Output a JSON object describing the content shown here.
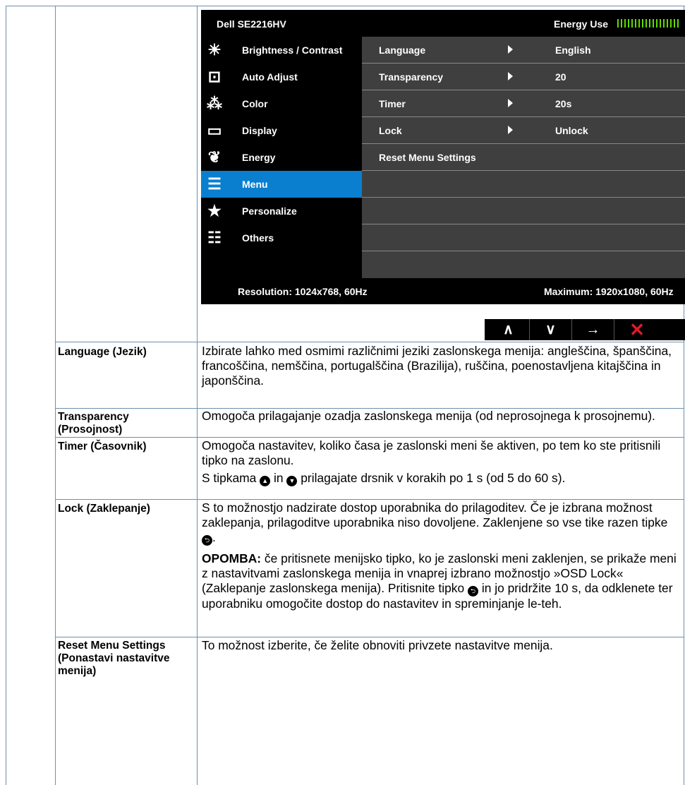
{
  "osd": {
    "title": "Dell SE2216HV",
    "energy_label": "Energy Use",
    "resolution": "Resolution: 1024x768, 60Hz",
    "maximum": "Maximum: 1920x1080, 60Hz",
    "menu_items": [
      {
        "label": "Brightness / Contrast",
        "icon": "brightness-icon",
        "glyph": "☀"
      },
      {
        "label": "Auto Adjust",
        "icon": "auto-adjust-icon",
        "glyph": "⊡"
      },
      {
        "label": "Color",
        "icon": "color-icon",
        "glyph": "⁂"
      },
      {
        "label": "Display",
        "icon": "display-icon",
        "glyph": "▭"
      },
      {
        "label": "Energy",
        "icon": "energy-icon",
        "glyph": "❦"
      },
      {
        "label": "Menu",
        "icon": "menu-icon",
        "glyph": "☰"
      },
      {
        "label": "Personalize",
        "icon": "star-icon",
        "glyph": "★"
      },
      {
        "label": "Others",
        "icon": "others-icon",
        "glyph": "☷"
      }
    ],
    "settings": [
      {
        "name": "Language",
        "value": "English"
      },
      {
        "name": "Transparency",
        "value": "20"
      },
      {
        "name": "Timer",
        "value": "20s"
      },
      {
        "name": "Lock",
        "value": "Unlock"
      },
      {
        "name": "Reset Menu Settings",
        "value": ""
      }
    ],
    "active_item": "Menu",
    "accent_color": "#0a7fd0"
  },
  "nav_buttons": {
    "up": "∧",
    "down": "∨",
    "enter": "→",
    "exit": "✕"
  },
  "rows": {
    "language": {
      "label": "Language (Jezik)",
      "desc": "Izbirate lahko med osmimi različnimi jeziki zaslonskega menija: angleščina, španščina, francoščina, nemščina, portugalščina (Brazilija), ruščina, poenostavljena kitajščina in japonščina."
    },
    "transparency": {
      "label": "Transparency (Prosojnost)",
      "desc": "Omogoča prilagajanje ozadja zaslonskega menija (od neprosojnega k prosojnemu)."
    },
    "timer": {
      "label": "Timer (Časovnik)",
      "desc1": "Omogoča nastavitev, koliko časa je zaslonski meni še aktiven, po tem ko ste pritisnili tipko na zaslonu.",
      "desc2_a": "S tipkama",
      "desc2_b": "in",
      "desc2_c": "prilagajate drsnik v korakih po 1 s (od 5 do 60 s)."
    },
    "lock": {
      "label": "Lock (Zaklepanje)",
      "desc1_a": "S to možnostjo nadzirate dostop uporabnika do prilagoditev. Če je izbrana možnost zaklepanja, prilagoditve uporabnika niso dovoljene. Zaklenjene so vse tike razen tipke",
      "desc1_b": ".",
      "note_label": "OPOMBA:",
      "note_a": " če pritisnete menijsko tipko, ko je zaslonski meni zaklenjen, se prikaže meni z nastavitvami zaslonskega menija in vnaprej izbrano možnostjo »OSD Lock« (Zaklepanje zaslonskega menija). Pritisnite tipko",
      "note_b": "in jo pridržite 10 s, da odklenete ter uporabniku omogočite dostop do nastavitev in spreminjanje le-teh."
    },
    "reset": {
      "label": "Reset Menu Settings (Ponastavi nastavitve menija)",
      "desc": "To možnost izberite, če želite obnoviti privzete nastavitve menija."
    }
  }
}
